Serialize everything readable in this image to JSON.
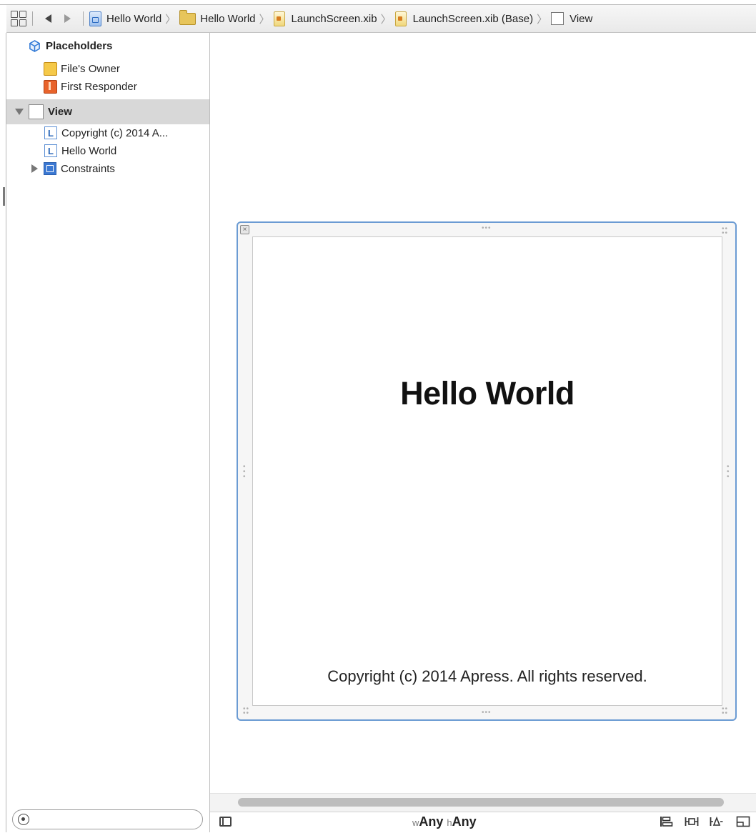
{
  "jump_bar": {
    "crumbs": [
      {
        "label": "Hello World",
        "icon": "project-file-icon"
      },
      {
        "label": "Hello World",
        "icon": "folder-icon"
      },
      {
        "label": "LaunchScreen.xib",
        "icon": "xib-file-icon"
      },
      {
        "label": "LaunchScreen.xib (Base)",
        "icon": "xib-file-icon"
      },
      {
        "label": "View",
        "icon": "view-icon"
      }
    ]
  },
  "outline": {
    "placeholders_label": "Placeholders",
    "files_owner": "File's Owner",
    "first_responder": "First Responder",
    "view_label": "View",
    "children": [
      {
        "label": "Copyright (c) 2014 A..."
      },
      {
        "label": "Hello World"
      },
      {
        "label": "Constraints"
      }
    ],
    "label_glyph": "L"
  },
  "canvas": {
    "title_label": "Hello World",
    "copyright_label": "Copyright (c) 2014 Apress. All rights reserved."
  },
  "bottom_bar": {
    "size_w_prefix": "w",
    "size_w_value": "Any",
    "size_h_prefix": "h",
    "size_h_value": "Any"
  },
  "colors": {
    "selection_border": "#6b9bd3",
    "selected_row": "#d8d8d8"
  }
}
